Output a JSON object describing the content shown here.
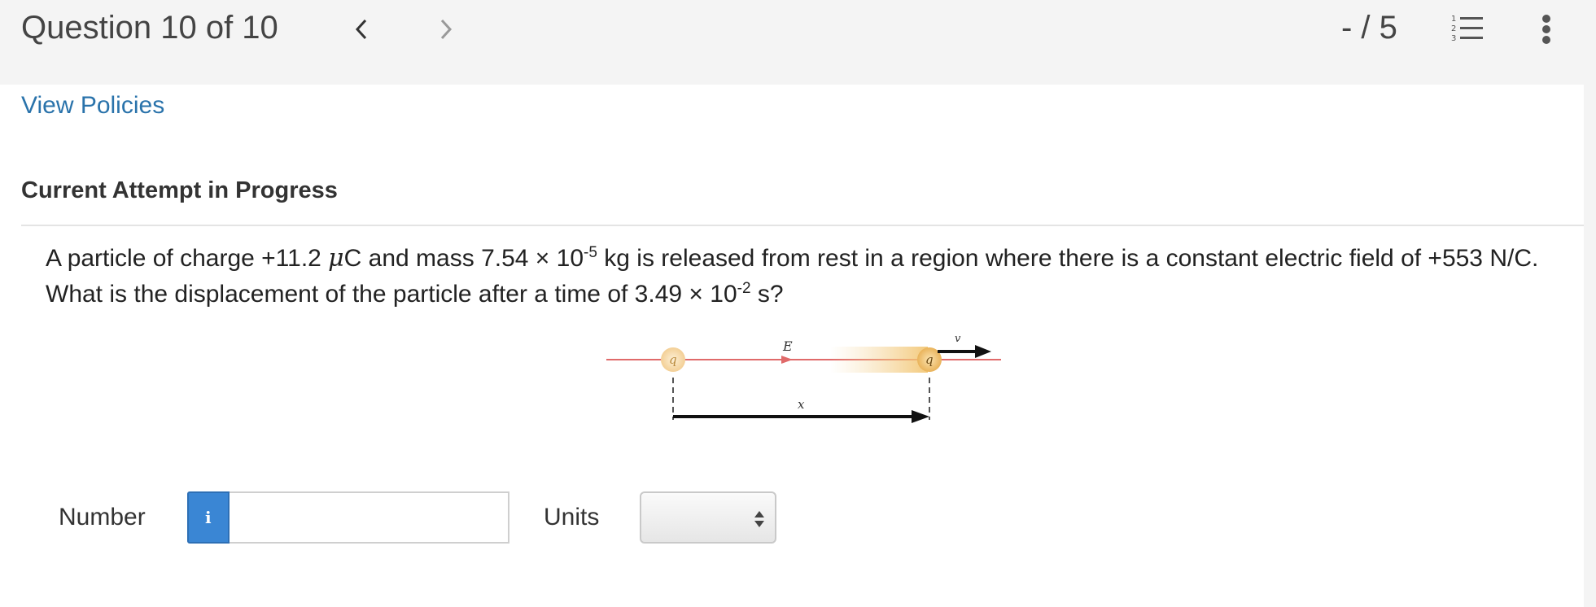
{
  "header": {
    "question_counter": "Question 10 of 10",
    "score": "- / 5"
  },
  "links": {
    "view_policies": "View Policies"
  },
  "attempt_heading": "Current Attempt in Progress",
  "question": {
    "part1": "A particle of charge +11.2 ",
    "mu": "μ",
    "part2": "C and mass 7.54 × 10",
    "exp1": "-5",
    "part3": " kg is released from rest in a region where there is a constant electric field of +553 N/C. What is the displacement of the particle after a time of 3.49 × 10",
    "exp2": "-2",
    "part4": " s?"
  },
  "diagram": {
    "label_q": "q",
    "label_E": "E",
    "label_v": "v",
    "label_x": "x"
  },
  "answer": {
    "number_label": "Number",
    "info_icon": "i",
    "number_value": "",
    "units_label": "Units",
    "units_selected": ""
  },
  "colors": {
    "link": "#2a73ab",
    "info_button": "#3a86d4",
    "field_line": "#e06a6a",
    "charge": "#f2c46e"
  },
  "icons": {
    "prev": "chevron-left-icon",
    "next": "chevron-right-icon",
    "list": "numbered-list-icon",
    "more": "vertical-ellipsis-icon",
    "info": "info-icon",
    "select": "up-down-arrows-icon"
  }
}
